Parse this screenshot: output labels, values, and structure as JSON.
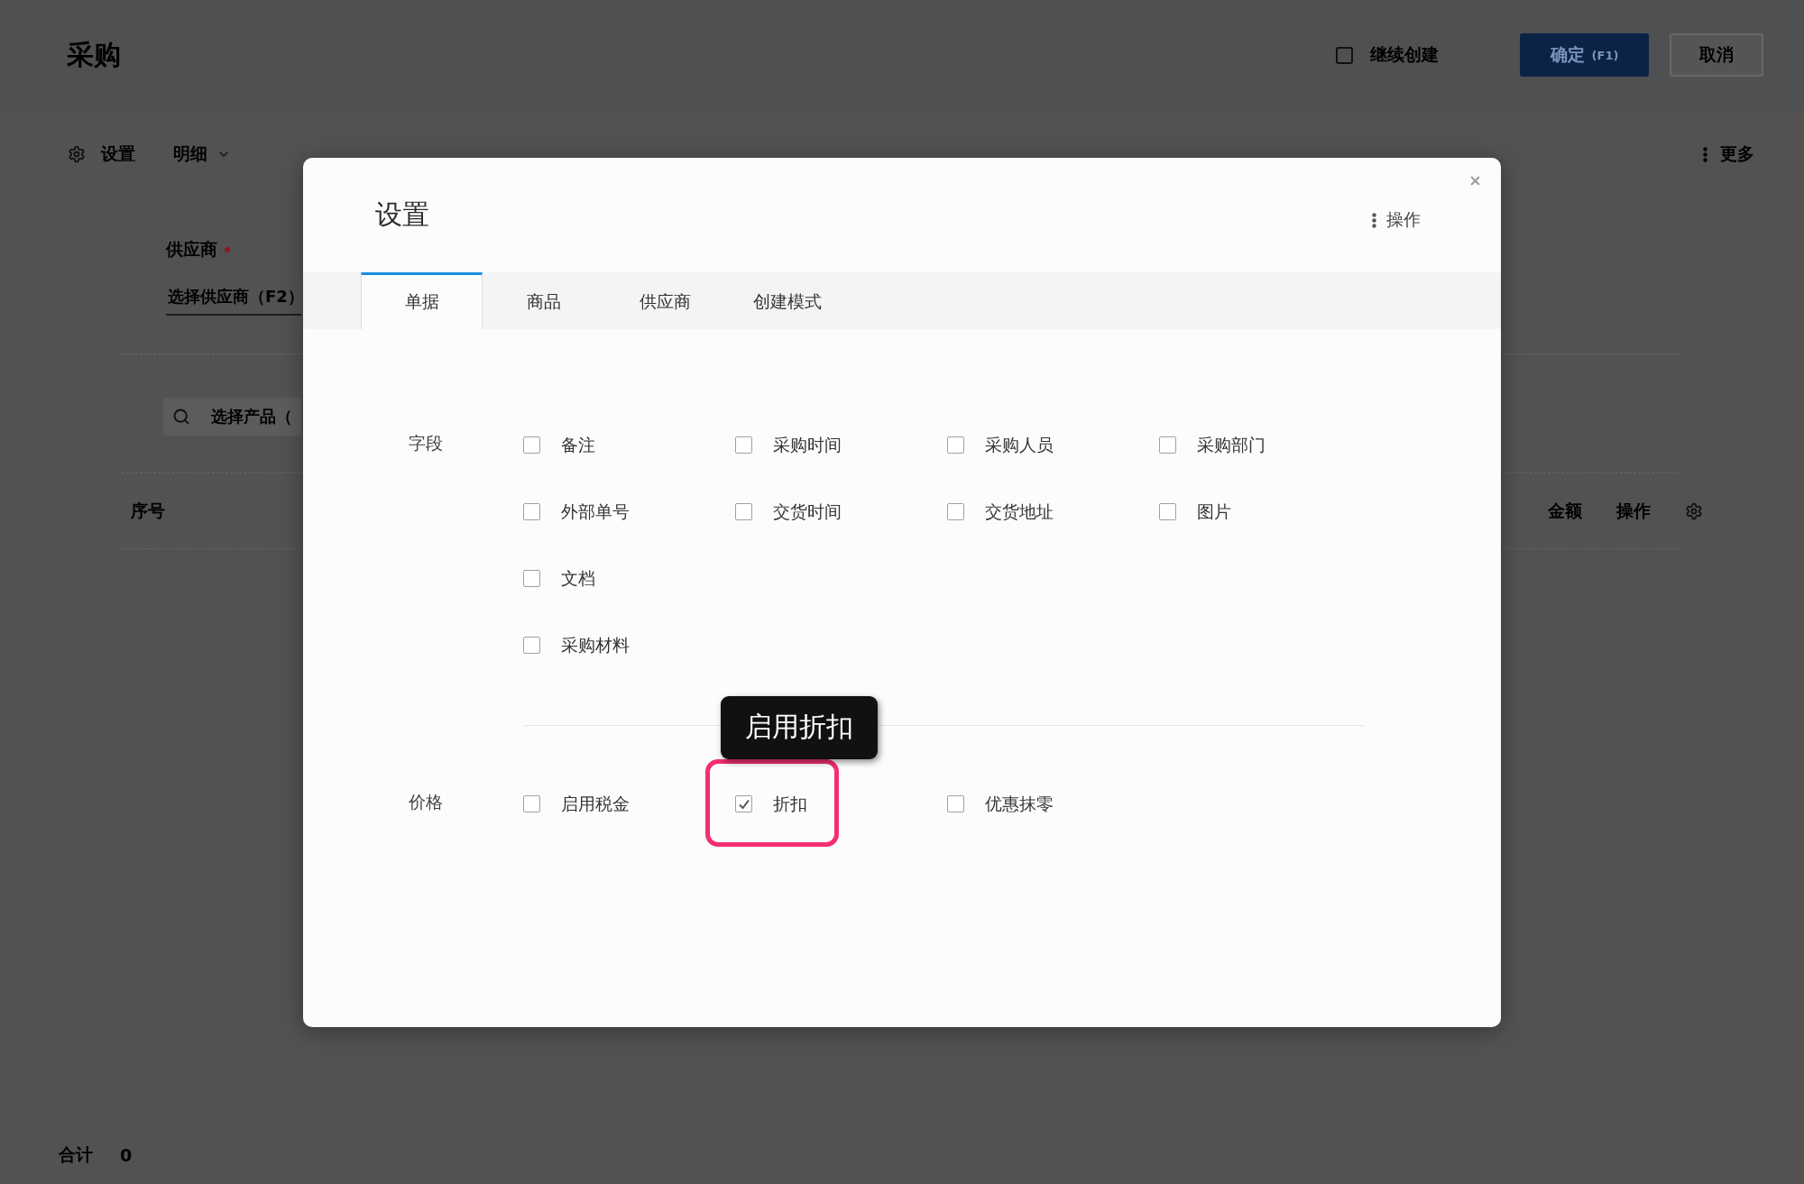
{
  "page": {
    "title": "采购",
    "continue_create": {
      "label": "继续创建",
      "checked": false
    },
    "buttons": [
      {
        "kind": "primary",
        "label": "确定",
        "shortcut": "(F1)"
      },
      {
        "kind": "default",
        "label": "取消"
      }
    ]
  },
  "toolbar": {
    "items": [
      {
        "kind": "settings",
        "label": "设置"
      },
      {
        "kind": "dropdown",
        "label": "明细"
      }
    ],
    "more": "更多"
  },
  "form": {
    "supplier": {
      "label": "供应商",
      "required": true,
      "placeholder": "选择供应商（F2）"
    },
    "product_search": {
      "placeholder": "选择产品（"
    }
  },
  "table": {
    "leading_columns": [
      "序号"
    ],
    "trailing_columns": [
      "金额",
      "操作"
    ]
  },
  "footer": {
    "total_label": "合计",
    "total_value": "0"
  },
  "dialog": {
    "title": "设置",
    "action": "操作",
    "tabs": [
      {
        "label": "单据",
        "selected": true
      },
      {
        "label": "商品",
        "selected": false
      },
      {
        "label": "供应商",
        "selected": false
      },
      {
        "label": "创建模式",
        "selected": false
      }
    ],
    "sections": [
      {
        "label": "字段",
        "rows": [
          [
            {
              "label": "备注",
              "checked": false,
              "highlighted": false
            },
            {
              "label": "采购时间",
              "checked": false,
              "highlighted": false
            },
            {
              "label": "采购人员",
              "checked": false,
              "highlighted": false
            },
            {
              "label": "采购部门",
              "checked": false,
              "highlighted": false
            }
          ],
          [
            {
              "label": "外部单号",
              "checked": false,
              "highlighted": false
            },
            {
              "label": "交货时间",
              "checked": false,
              "highlighted": false
            },
            {
              "label": "交货地址",
              "checked": false,
              "highlighted": false
            },
            {
              "label": "图片",
              "checked": false,
              "highlighted": false
            }
          ],
          [
            {
              "label": "文档",
              "checked": false,
              "highlighted": false
            }
          ],
          [
            {
              "label": "采购材料",
              "checked": false,
              "highlighted": false
            }
          ]
        ]
      },
      {
        "label": "价格",
        "rows": [
          [
            {
              "label": "启用税金",
              "checked": false,
              "highlighted": false
            },
            {
              "label": "折扣",
              "checked": true,
              "highlighted": true
            },
            {
              "label": "优惠抹零",
              "checked": false,
              "highlighted": false
            }
          ]
        ]
      }
    ],
    "tooltip": "启用折扣"
  }
}
